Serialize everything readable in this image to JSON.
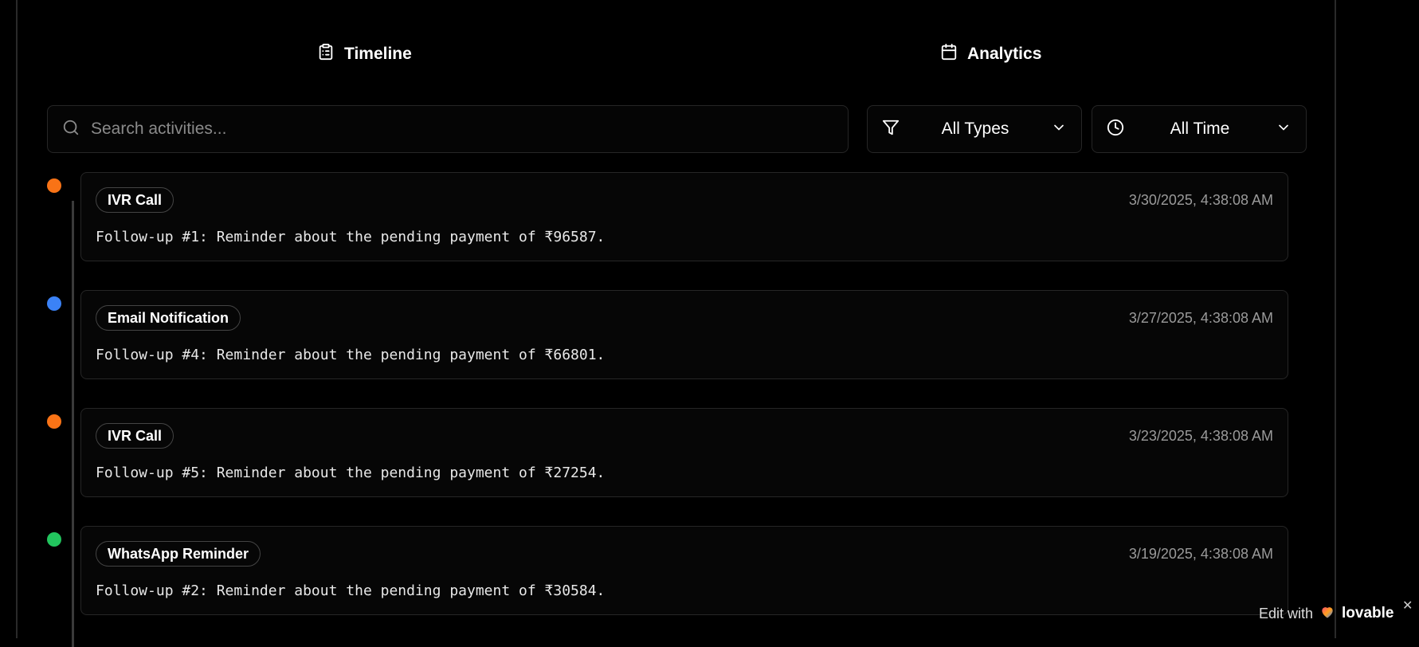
{
  "tabs": [
    {
      "label": "Timeline",
      "icon": "clipboard-list-icon"
    },
    {
      "label": "Analytics",
      "icon": "calendar-icon"
    }
  ],
  "search": {
    "placeholder": "Search activities...",
    "value": "",
    "icon": "search-icon"
  },
  "filters": {
    "type": {
      "value": "All Types",
      "icon": "filter-icon"
    },
    "time": {
      "value": "All Time",
      "icon": "clock-icon"
    }
  },
  "activities": [
    {
      "type": "IVR Call",
      "color": "#f97316",
      "timestamp": "3/30/2025, 4:38:08 AM",
      "message": "Follow-up #1: Reminder about the pending payment of ₹96587."
    },
    {
      "type": "Email Notification",
      "color": "#3b82f6",
      "timestamp": "3/27/2025, 4:38:08 AM",
      "message": "Follow-up #4: Reminder about the pending payment of ₹66801."
    },
    {
      "type": "IVR Call",
      "color": "#f97316",
      "timestamp": "3/23/2025, 4:38:08 AM",
      "message": "Follow-up #5: Reminder about the pending payment of ₹27254."
    },
    {
      "type": "WhatsApp Reminder",
      "color": "#22c55e",
      "timestamp": "3/19/2025, 4:38:08 AM",
      "message": "Follow-up #2: Reminder about the pending payment of ₹30584."
    }
  ],
  "badge": {
    "prefix": "Edit with",
    "brand": "lovable",
    "close": "✕"
  }
}
